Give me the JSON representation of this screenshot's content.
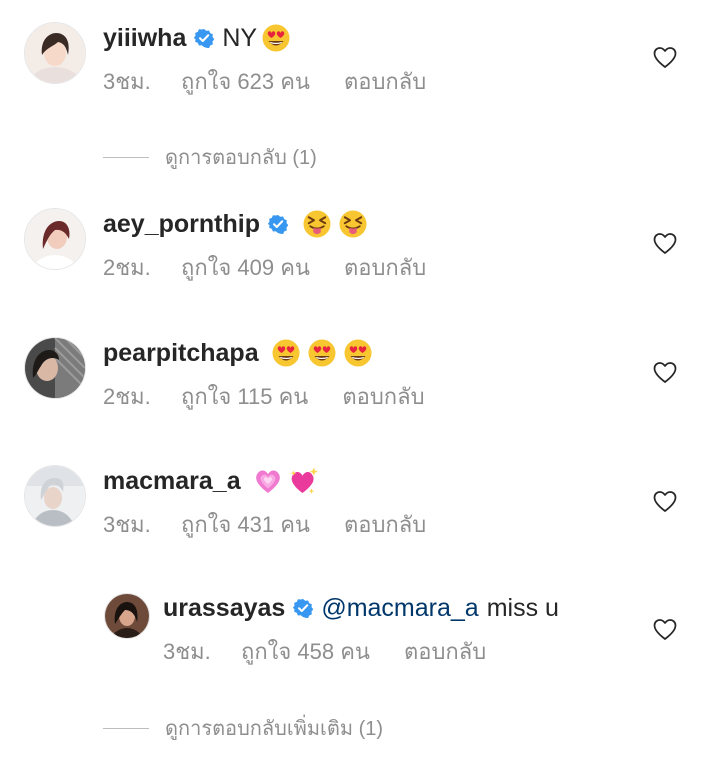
{
  "comments": [
    {
      "username": "yiiiwha",
      "verified": true,
      "text": "NY",
      "emojis": [
        "heart-eyes-emoji"
      ],
      "time": "3ชม.",
      "likes": "ถูกใจ 623 คน",
      "reply_label": "ตอบกลับ"
    },
    {
      "username": "aey_pornthip",
      "verified": true,
      "text": "",
      "emojis": [
        "squinting-tongue-emoji",
        "squinting-tongue-emoji"
      ],
      "time": "2ชม.",
      "likes": "ถูกใจ 409 คน",
      "reply_label": "ตอบกลับ"
    },
    {
      "username": "pearpitchapa",
      "verified": false,
      "text": "",
      "emojis": [
        "heart-eyes-emoji",
        "heart-eyes-emoji",
        "heart-eyes-emoji"
      ],
      "time": "2ชม.",
      "likes": "ถูกใจ 115 คน",
      "reply_label": "ตอบกลับ"
    },
    {
      "username": "macmara_a",
      "verified": false,
      "text": "",
      "emojis": [
        "growing-heart-emoji",
        "sparkling-heart-emoji"
      ],
      "time": "3ชม.",
      "likes": "ถูกใจ 431 คน",
      "reply_label": "ตอบกลับ"
    }
  ],
  "reply": {
    "username": "urassayas",
    "verified": true,
    "mention": "@macmara_a",
    "text": "miss u",
    "time": "3ชม.",
    "likes": "ถูกใจ 458 คน",
    "reply_label": "ตอบกลับ"
  },
  "view_replies_1": "ดูการตอบกลับ (1)",
  "view_more_replies": "ดูการตอบกลับเพิ่มเติม (1)",
  "colors": {
    "text": "#262626",
    "meta": "#8e8e8e",
    "mention": "#00376b",
    "verified": "#3897f0"
  }
}
